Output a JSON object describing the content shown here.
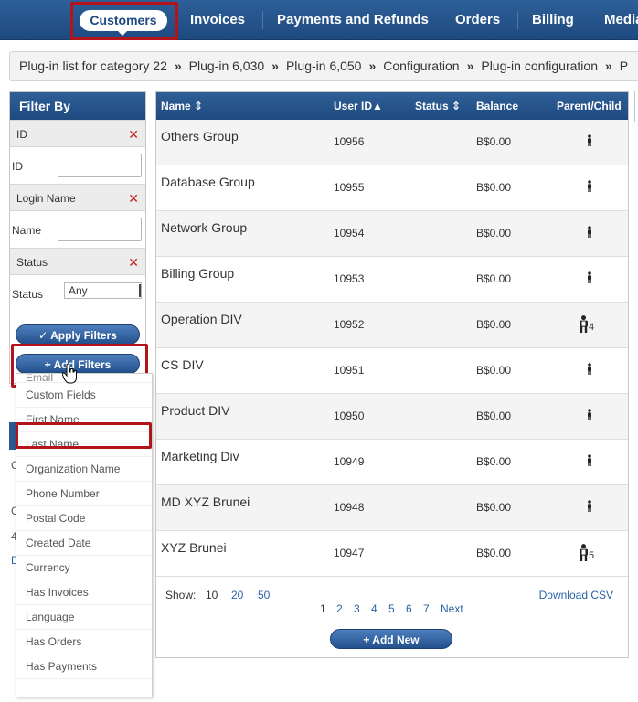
{
  "nav": {
    "active": "Customers",
    "items": [
      "Invoices",
      "Payments and Refunds",
      "Orders",
      "Billing",
      "Media"
    ]
  },
  "breadcrumb": [
    "Plug-in list for category 22",
    "Plug-in 6,030",
    "Plug-in 6,050",
    "Configuration",
    "Plug-in configuration",
    "P"
  ],
  "filter": {
    "title": "Filter By",
    "sections": [
      {
        "head": "ID",
        "label": "ID"
      },
      {
        "head": "Login Name",
        "label": "Name"
      },
      {
        "head": "Status",
        "label": "Status",
        "value": "Any"
      }
    ],
    "apply_label": "Apply Filters",
    "add_label": "Add Filters",
    "remove_glyph": "✕"
  },
  "dropdown": [
    "Email",
    "Custom Fields",
    "First Name",
    "Last Name",
    "Organization Name",
    "Phone Number",
    "Postal Code",
    "Created Date",
    "Currency",
    "Has Invoices",
    "Language",
    "Has Orders",
    "Has Payments"
  ],
  "lower_panel_fragments": [
    "C",
    "C",
    "4",
    "D"
  ],
  "table": {
    "columns": [
      "Name",
      "User ID",
      "Status",
      "Balance",
      "Parent/Child"
    ],
    "rows": [
      {
        "name": "Others Group",
        "id": "10956",
        "balance": "B$0.00",
        "children": ""
      },
      {
        "name": "Database Group",
        "id": "10955",
        "balance": "B$0.00",
        "children": ""
      },
      {
        "name": "Network Group",
        "id": "10954",
        "balance": "B$0.00",
        "children": ""
      },
      {
        "name": "Billing Group",
        "id": "10953",
        "balance": "B$0.00",
        "children": ""
      },
      {
        "name": "Operation DIV",
        "id": "10952",
        "balance": "B$0.00",
        "children": "4"
      },
      {
        "name": "CS DIV",
        "id": "10951",
        "balance": "B$0.00",
        "children": ""
      },
      {
        "name": "Product DIV",
        "id": "10950",
        "balance": "B$0.00",
        "children": ""
      },
      {
        "name": "Marketing Div",
        "id": "10949",
        "balance": "B$0.00",
        "children": ""
      },
      {
        "name": "MD XYZ Brunei",
        "id": "10948",
        "balance": "B$0.00",
        "children": ""
      },
      {
        "name": "XYZ Brunei",
        "id": "10947",
        "balance": "B$0.00",
        "children": "5"
      }
    ],
    "show_label": "Show:",
    "page_sizes": [
      "10",
      "20",
      "50"
    ],
    "download_label": "Download CSV",
    "pages": [
      "1",
      "2",
      "3",
      "4",
      "5",
      "6",
      "7"
    ],
    "next_label": "Next",
    "add_new_label": "Add New"
  },
  "colors": {
    "nav_bg": "#1e4a80",
    "highlight": "#b3141b",
    "link": "#2a63a8"
  }
}
